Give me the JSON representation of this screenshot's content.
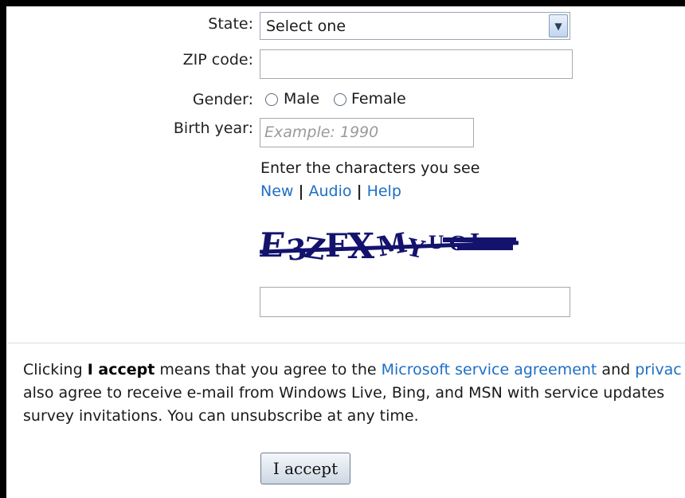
{
  "form": {
    "state_label": "State:",
    "state_value": "Select one",
    "zip_label": "ZIP code:",
    "zip_value": "",
    "gender_label": "Gender:",
    "gender_options": [
      "Male",
      "Female"
    ],
    "birth_year_label": "Birth year:",
    "birth_year_placeholder": "Example: 1990"
  },
  "captcha": {
    "prompt": "Enter the characters you see",
    "links": {
      "new": "New",
      "separator": "|",
      "audio": "Audio",
      "help": "Help"
    },
    "image_text": "E3ZFXMYUGL",
    "answer_value": ""
  },
  "legal": {
    "line1_pre": "Clicking ",
    "line1_bold": "I accept",
    "line1_mid": " means that you agree to the ",
    "link_agreement": "Microsoft service agreement",
    "line1_and": " and ",
    "link_privacy": "privac",
    "line2": "also agree to receive e-mail from Windows Live, Bing, and MSN with service updates",
    "line3": "survey invitations. You can unsubscribe at any time."
  },
  "accept_button": "I accept",
  "colors": {
    "link": "#1e6fc4",
    "captcha_ink": "#13136e"
  }
}
